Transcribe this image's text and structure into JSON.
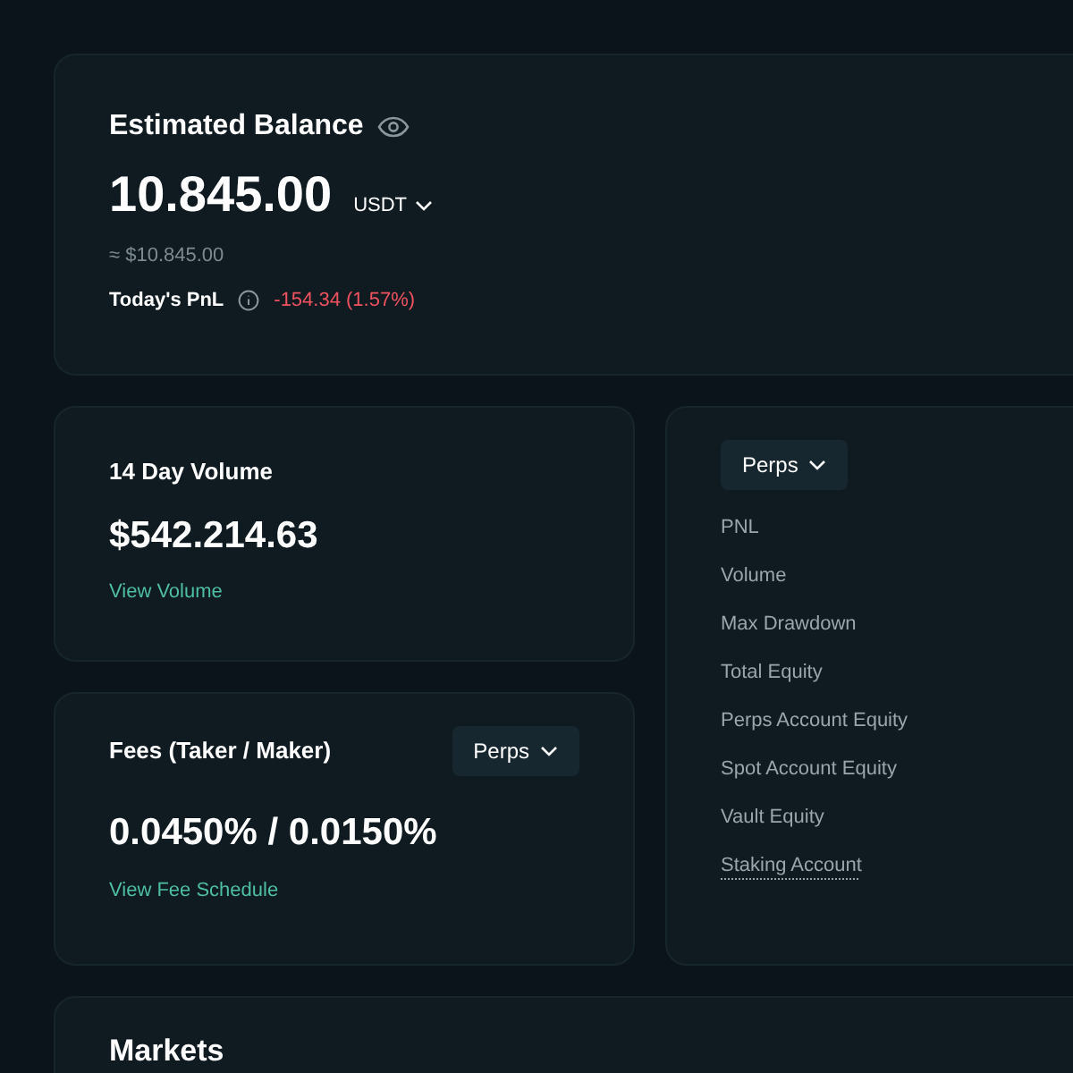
{
  "balance": {
    "title": "Estimated Balance",
    "amount": "10.845.00",
    "currency": "USDT",
    "fiat": "≈ $10.845.00",
    "pnl_label": "Today's PnL",
    "pnl_value": "-154.34 (1.57%)"
  },
  "volume": {
    "title": "14 Day Volume",
    "amount": "$542.214.63",
    "link": "View Volume"
  },
  "fees": {
    "title": "Fees (Taker / Maker)",
    "dropdown": "Perps",
    "amount": "0.0450% / 0.0150%",
    "link": "View Fee Schedule"
  },
  "metrics": {
    "dropdown": "Perps",
    "items": [
      {
        "label": "PNL",
        "underlined": false
      },
      {
        "label": "Volume",
        "underlined": false
      },
      {
        "label": "Max Drawdown",
        "underlined": false
      },
      {
        "label": "Total Equity",
        "underlined": false
      },
      {
        "label": "Perps Account Equity",
        "underlined": false
      },
      {
        "label": "Spot Account Equity",
        "underlined": false
      },
      {
        "label": "Vault Equity",
        "underlined": false
      },
      {
        "label": "Staking Account",
        "underlined": true
      }
    ]
  },
  "markets": {
    "title": "Markets"
  }
}
